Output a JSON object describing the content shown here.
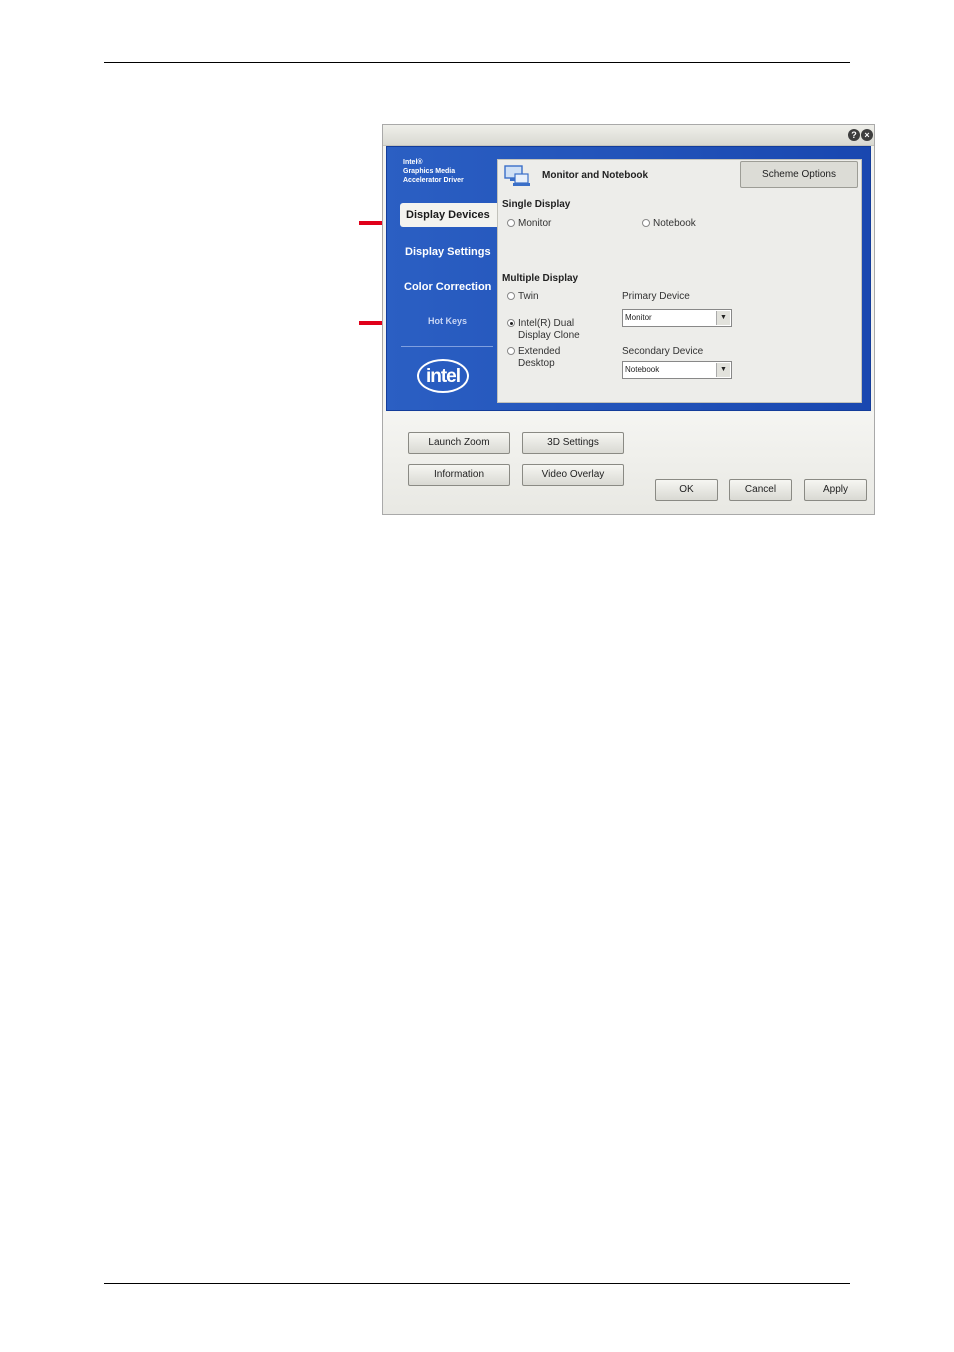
{
  "window": {
    "help_glyph": "?",
    "close_glyph": "×",
    "brand_lines": [
      "Intel®",
      "Graphics Media",
      "Accelerator Driver"
    ],
    "logo_text": "intel"
  },
  "sidebar": {
    "items": [
      {
        "label": "Display Devices"
      },
      {
        "label": "Display Settings"
      },
      {
        "label": "Color Correction"
      },
      {
        "label": "Hot Keys"
      }
    ]
  },
  "panel": {
    "title": "Monitor and Notebook",
    "scheme_button": "Scheme Options",
    "single_display_label": "Single Display",
    "single_options": [
      {
        "label": "Monitor",
        "selected": false
      },
      {
        "label": "Notebook",
        "selected": false
      }
    ],
    "multiple_display_label": "Multiple Display",
    "multiple_options": [
      {
        "label": "Twin",
        "selected": false
      },
      {
        "label_lines": [
          "Intel(R) Dual",
          "Display Clone"
        ],
        "selected": true
      },
      {
        "label_lines": [
          "Extended",
          "Desktop"
        ],
        "selected": false
      }
    ],
    "primary_device_label": "Primary Device",
    "primary_device_value": "Monitor",
    "secondary_device_label": "Secondary Device",
    "secondary_device_value": "Notebook"
  },
  "buttons": {
    "launch_zoom": "Launch Zoom",
    "settings_3d": "3D Settings",
    "information": "Information",
    "video_overlay": "Video Overlay",
    "ok": "OK",
    "cancel": "Cancel",
    "apply": "Apply"
  },
  "colors": {
    "sidebar_blue": "#1947b0",
    "callout_red": "#e0001a"
  }
}
